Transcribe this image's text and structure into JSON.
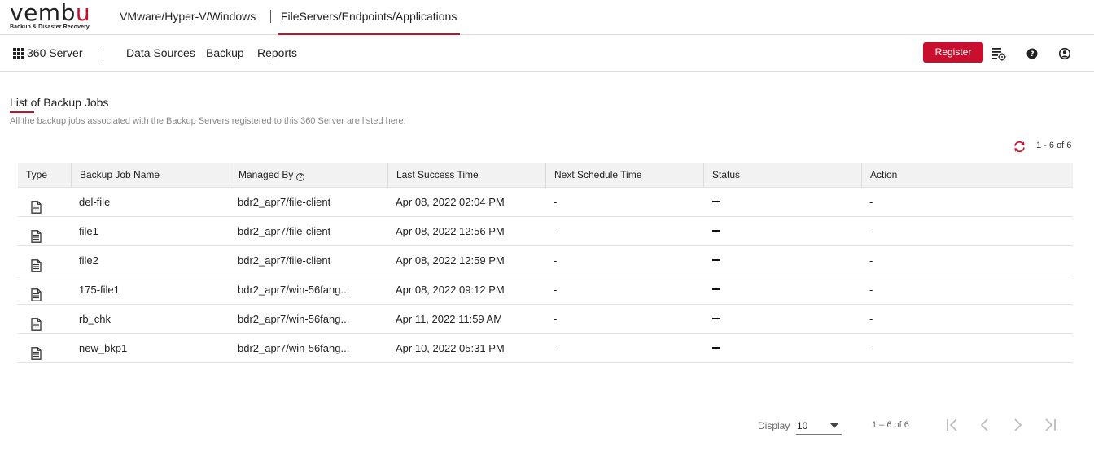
{
  "brand": {
    "logo_text_a": "vemb",
    "logo_text_b": "u",
    "tagline": "Backup & Disaster Recovery"
  },
  "product_tabs": [
    {
      "label": "VMware/Hyper-V/Windows",
      "active": false
    },
    {
      "label": "FileServers/Endpoints/Applications",
      "active": true
    }
  ],
  "navbar": {
    "product_label": "360 Server",
    "links": [
      "Data Sources",
      "Backup",
      "Reports"
    ],
    "register_label": "Register",
    "icons": [
      "settings-list-icon",
      "help-icon",
      "user-account-icon"
    ]
  },
  "page": {
    "title": "List of Backup Jobs",
    "subtitle": "All the backup jobs associated with the Backup Servers registered to this 360 Server are listed here.",
    "count_label": "1 - 6 of 6"
  },
  "table": {
    "columns": [
      "Type",
      "Backup Job Name",
      "Managed By",
      "Last Success Time",
      "Next Schedule Time",
      "Status",
      "Action"
    ],
    "managed_by_help": "?",
    "rows": [
      {
        "type_icon": "document-icon",
        "name": "del-file",
        "managed_by": "bdr2_apr7/file-client",
        "last_success": "Apr 08, 2022 02:04 PM",
        "next_schedule": "-",
        "status": "dash",
        "action": "-"
      },
      {
        "type_icon": "document-icon",
        "name": "file1",
        "managed_by": "bdr2_apr7/file-client",
        "last_success": "Apr 08, 2022 12:56 PM",
        "next_schedule": "-",
        "status": "dash",
        "action": "-"
      },
      {
        "type_icon": "document-icon",
        "name": "file2",
        "managed_by": "bdr2_apr7/file-client",
        "last_success": "Apr 08, 2022 12:59 PM",
        "next_schedule": "-",
        "status": "dash",
        "action": "-"
      },
      {
        "type_icon": "document-icon",
        "name": "175-file1",
        "managed_by": "bdr2_apr7/win-56fang...",
        "last_success": "Apr 08, 2022 09:12 PM",
        "next_schedule": "-",
        "status": "dash",
        "action": "-"
      },
      {
        "type_icon": "document-icon",
        "name": "rb_chk",
        "managed_by": "bdr2_apr7/win-56fang...",
        "last_success": "Apr 11, 2022 11:59 AM",
        "next_schedule": "-",
        "status": "dash",
        "action": "-"
      },
      {
        "type_icon": "document-icon",
        "name": "new_bkp1",
        "managed_by": "bdr2_apr7/win-56fang...",
        "last_success": "Apr 10, 2022 05:31 PM",
        "next_schedule": "-",
        "status": "dash",
        "action": "-"
      }
    ]
  },
  "pagination": {
    "display_label": "Display",
    "display_value": "10",
    "range_label": "1 – 6 of 6"
  },
  "colors": {
    "accent": "#c8102e",
    "header_bg": "#f2f2f2",
    "border": "#e2e2e2"
  }
}
